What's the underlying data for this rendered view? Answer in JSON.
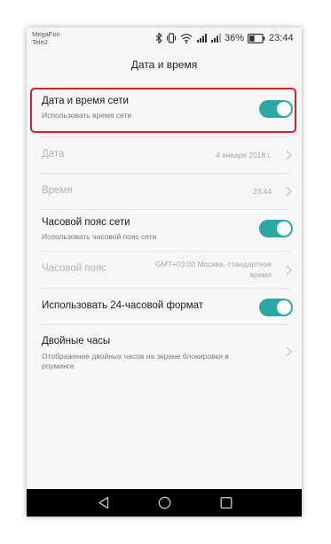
{
  "status_bar": {
    "carrier_1": "MegaFon",
    "carrier_2": "Tele2",
    "battery": "36%",
    "time": "23:44",
    "icons": [
      "bluetooth-icon",
      "vibrate-icon",
      "wifi-icon",
      "signal-icon",
      "signal-icon",
      "battery-icon"
    ]
  },
  "header": {
    "title": "Дата и время"
  },
  "settings": {
    "network_time": {
      "label": "Дата и время сети",
      "sub": "Использовать время сети",
      "enabled": true
    },
    "date": {
      "label": "Дата",
      "value": "4 января 2018 г."
    },
    "time": {
      "label": "Время",
      "value": "23:44"
    },
    "network_timezone": {
      "label": "Часовой пояс сети",
      "sub": "Использовать часовой пояс сети",
      "enabled": true
    },
    "timezone": {
      "label": "Часовой пояс",
      "value_line1": "GMT+03:00 Москва, стандартное",
      "value_line2": "время"
    },
    "format24": {
      "label": "Использовать 24-часовой формат",
      "enabled": true
    },
    "dual_clock": {
      "label": "Двойные часы",
      "sub_line1": "Отображение двойных часов на экране блокировки в",
      "sub_line2": "роуминге"
    }
  },
  "navigation": {
    "icons": [
      "back-icon",
      "home-icon",
      "recents-icon"
    ]
  },
  "colors": {
    "accent": "#2ba8a4",
    "highlight": "#d2232a",
    "background": "#f6f6f6"
  }
}
